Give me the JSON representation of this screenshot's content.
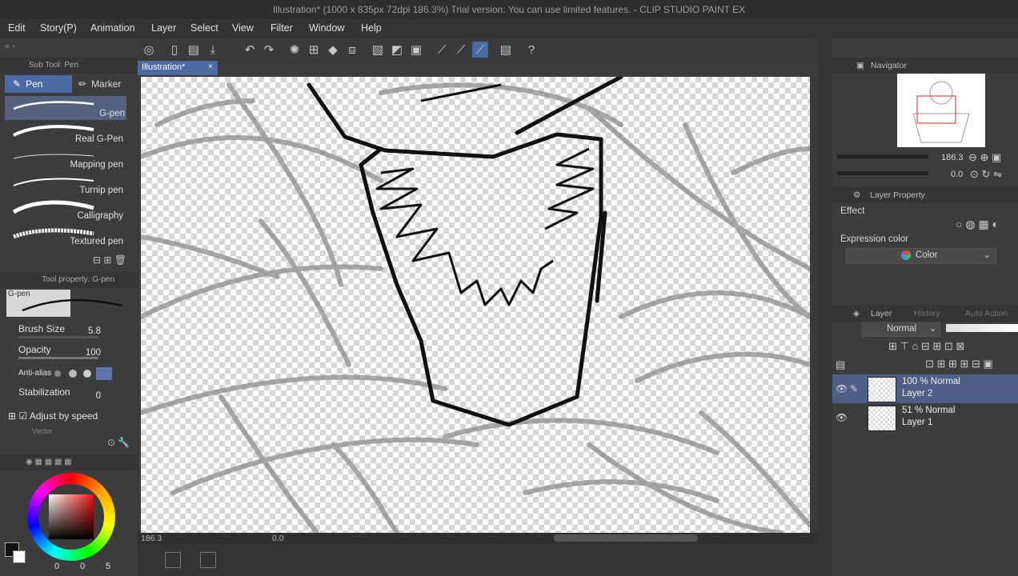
{
  "titlebar": {
    "title": "Illustration* (1000 x 835px 72dpi 186.3%)  Trial version: You can use limited features. - CLIP STUDIO PAINT EX"
  },
  "menu": [
    "Edit",
    "Story(P)",
    "Animation",
    "Layer",
    "Select",
    "View",
    "Filter",
    "Window",
    "Help"
  ],
  "subtool": {
    "header": "Sub Tool: Pen",
    "tabs": [
      {
        "label": "Pen"
      },
      {
        "label": "Marker"
      }
    ],
    "brushes": [
      "G-pen",
      "Real G-Pen",
      "Mapping pen",
      "Turnip pen",
      "Calligraphy",
      "Textured pen"
    ]
  },
  "toolprop": {
    "header": "Tool property: G-pen",
    "preview_label": "G-pen",
    "brush_size_label": "Brush Size",
    "brush_size_value": "5.8",
    "opacity_label": "Opacity",
    "opacity_value": "100",
    "antialias_label": "Anti-alias",
    "stabilization_label": "Stabilization",
    "stabilization_value": "0",
    "adjust_label": "Adjust by speed",
    "vector_label": "Vector"
  },
  "color": {
    "fg": "#1a1a1a",
    "bg": "#ffffff",
    "values": [
      "0",
      "0",
      "5"
    ]
  },
  "canvas": {
    "tab_label": "Illustration*",
    "zoom": "186.3",
    "rotation": "0.0"
  },
  "navigator": {
    "title": "Navigator",
    "zoom": "186.3",
    "rotation": "0.0"
  },
  "layer_property": {
    "title": "Layer Property",
    "effect_label": "Effect",
    "expression_label": "Expression color",
    "expression_value": "Color"
  },
  "layers_panel": {
    "tabs": [
      "Layer",
      "History",
      "Auto Action"
    ],
    "blend_mode": "Normal",
    "layers": [
      {
        "mode": "100 % Normal",
        "name": "Layer 2",
        "selected": true
      },
      {
        "mode": "51 % Normal",
        "name": "Layer 1",
        "selected": false
      }
    ]
  },
  "colors": {
    "accent": "#4b6aa3",
    "panel": "#3c3c3c",
    "selected_row": "#4e5f88"
  }
}
